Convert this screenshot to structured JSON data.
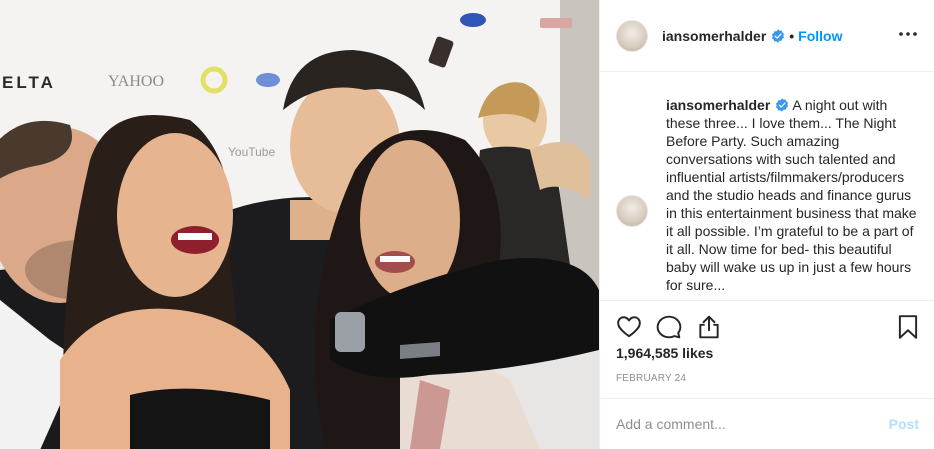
{
  "photo": {
    "alt_icons": [
      "photo-image"
    ],
    "sponsor_text": [
      "ELTA",
      "YAHOO",
      "YouTube"
    ]
  },
  "header": {
    "username": "iansomerhalder",
    "separator": "•",
    "follow_label": "Follow",
    "verified_icon": "verified-badge-icon",
    "more_icon": "more-options-icon"
  },
  "caption": {
    "username": "iansomerhalder",
    "text": "A night out with these three... I love them... The Night Before Party. Such amazing conversations with such talented and influential artists/filmmakers/producers and the studio heads and finance gurus in this entertainment business that make it all possible. I’m grateful to be a part of it all. Now time for bed- this beautiful baby will wake us up in just a few hours for sure..."
  },
  "actions": {
    "like_icon": "heart-icon",
    "comment_icon": "comment-icon",
    "share_icon": "share-icon",
    "save_icon": "bookmark-icon"
  },
  "likes": "1,964,585 likes",
  "date": "FEBRUARY 24",
  "comment": {
    "placeholder": "Add a comment...",
    "post_label": "Post"
  },
  "colors": {
    "accent": "#0095f6",
    "post_disabled": "#b2dffc",
    "muted": "#8e8e8e"
  }
}
